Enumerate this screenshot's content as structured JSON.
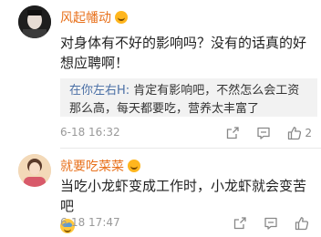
{
  "comments": [
    {
      "username": "风起幡动",
      "body": "对身体有不好的影响吗？没有的话真的好想应聘啊！",
      "reply": {
        "author": "在你左右H",
        "text": "肯定有影响吧，不然怎么会工资那么高，每天都要吃，营养太丰富了"
      },
      "timestamp": "6-18 16:32",
      "like_count": "2"
    },
    {
      "username": "就要吃菜菜",
      "body": "当吃小龙虾变成工作时，小龙虾就会变苦吧",
      "timestamp": "6-18 17:47",
      "like_count": ""
    }
  ],
  "reply_separator": ": ",
  "colors": {
    "username": "#e8711c",
    "reply_author": "#4a6fa5",
    "reply_bg": "#f2f2f2",
    "meta_gray": "#999999"
  },
  "icons": [
    "badge-icon",
    "share-icon",
    "comment-icon",
    "like-icon",
    "emoji-icon"
  ]
}
